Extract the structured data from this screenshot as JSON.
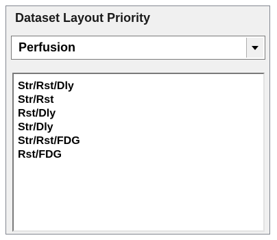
{
  "panel": {
    "title": "Dataset Layout Priority",
    "combo": {
      "value": "Perfusion",
      "arrow_icon": "chevron-down-icon"
    },
    "list": {
      "items": [
        "Str/Rst/Dly",
        "Str/Rst",
        "Rst/Dly",
        "Str/Dly",
        "Str/Rst/FDG",
        "Rst/FDG"
      ]
    }
  }
}
